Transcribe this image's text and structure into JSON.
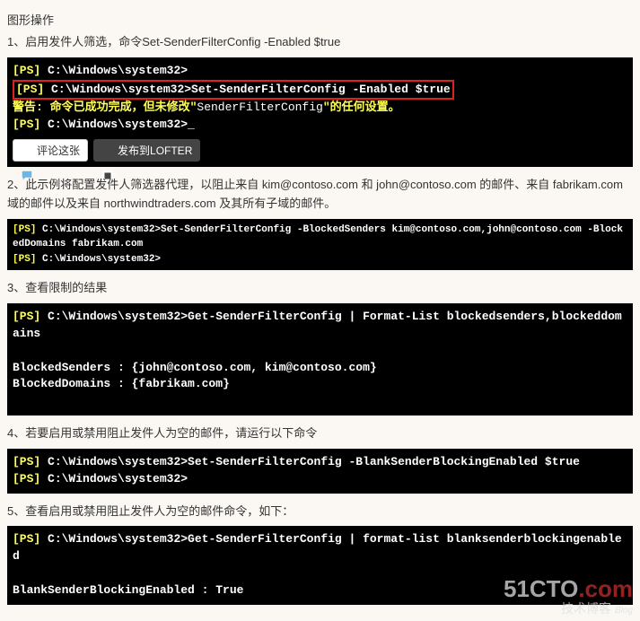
{
  "heading": "图形操作",
  "steps": {
    "s1": {
      "title": "1、启用发件人筛选，命令Set-SenderFilterConfig -Enabled $true"
    },
    "s2": {
      "title": "2、此示例将配置发件人筛选器代理，以阻止来自 kim@contoso.com 和 john@contoso.com 的邮件、来自 fabrikam.com 域的邮件以及来自 northwindtraders.com 及其所有子域的邮件。"
    },
    "s3": {
      "title": "3、查看限制的结果"
    },
    "s4": {
      "title": "4、若要启用或禁用阻止发件人为空的邮件，请运行以下命令"
    },
    "s5": {
      "title": "5、查看启用或禁用阻止发件人为空的邮件命令，如下："
    }
  },
  "term1": {
    "l1_ps": "[PS]",
    "l1_path": " C:\\Windows\\system32>",
    "l2_ps": "[PS]",
    "l2_path": " C:\\Windows\\system32>",
    "l2_cmd": "Set-SenderFilterConfig -Enabled $true",
    "l3_warn": "警告: 命令已成功完成，但未修改\"",
    "l3_obj": "SenderFilterConfig",
    "l3_warn2": "\"的任何设置。",
    "l4_ps": "[PS]",
    "l4_path": " C:\\Windows\\system32>",
    "l4_cursor": "_"
  },
  "btns": {
    "comment": "评论这张",
    "lofter": "发布到LOFTER"
  },
  "term2": {
    "l1_ps": "[PS]",
    "l1_path": " C:\\Windows\\system32>",
    "l1_cmd": "Set-SenderFilterConfig -BlockedSenders kim@contoso.com,john@contoso.com -BlockedDomains fabrikam.com",
    "l2_ps": "[PS]",
    "l2_path": " C:\\Windows\\system32>"
  },
  "term3": {
    "l1_ps": "[PS]",
    "l1_path": " C:\\Windows\\system32>",
    "l1_cmd": "Get-SenderFilterConfig | Format-List blockedsenders,blockeddomains",
    "blank": " ",
    "out1": "BlockedSenders : {john@contoso.com, kim@contoso.com}",
    "out2": "BlockedDomains : {fabrikam.com}"
  },
  "term4": {
    "l1_ps": "[PS]",
    "l1_path": " C:\\Windows\\system32>",
    "l1_cmd": "Set-SenderFilterConfig -BlankSenderBlockingEnabled $true",
    "l2_ps": "[PS]",
    "l2_path": " C:\\Windows\\system32>"
  },
  "term5": {
    "l1_ps": "[PS]",
    "l1_path": " C:\\Windows\\system32>",
    "l1_cmd": "Get-SenderFilterConfig | format-list blanksenderblockingenabled",
    "blank": " ",
    "out1": "BlankSenderBlockingEnabled : True"
  },
  "watermark": {
    "line1a": "51CTO",
    "line1b": ".com",
    "line2": "技术博客",
    "blog": "Blog"
  }
}
